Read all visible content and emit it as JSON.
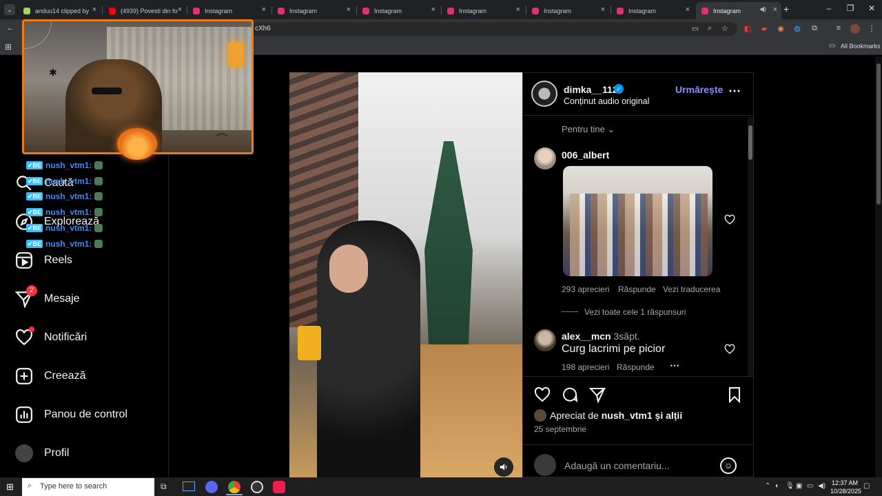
{
  "browser": {
    "tabs": [
      {
        "title": "anduu14 clipped by",
        "color": "#a4d65e"
      },
      {
        "title": "(4939) Povesti din fo",
        "color": "#ff0000"
      },
      {
        "title": "Instagram",
        "color": "#e1306c"
      },
      {
        "title": "Instagram",
        "color": "#e1306c"
      },
      {
        "title": "Instagram",
        "color": "#e1306c"
      },
      {
        "title": "Instagram",
        "color": "#e1306c"
      },
      {
        "title": "Instagram",
        "color": "#e1306c"
      },
      {
        "title": "Instagram",
        "color": "#e1306c"
      },
      {
        "title": "Instagram",
        "color": "#e1306c"
      }
    ],
    "new_tab": "+",
    "url": "cXh6",
    "bookmarks_label": "All Bookmarks"
  },
  "overlay": {
    "chat": [
      {
        "user": "nush_vtm1:"
      },
      {
        "user": "nush_vtm1:"
      },
      {
        "user": "nush_vtm1:"
      },
      {
        "user": "nush_vtm1:"
      },
      {
        "user": "nush_vtm1:"
      },
      {
        "user": "nush_vtm1:"
      }
    ]
  },
  "sidebar": {
    "items": [
      {
        "label": "Caută",
        "icon": "search-icon"
      },
      {
        "label": "Explorează",
        "icon": "compass-icon"
      },
      {
        "label": "Reels",
        "icon": "reels-icon"
      },
      {
        "label": "Mesaje",
        "icon": "messenger-icon",
        "badge": "2"
      },
      {
        "label": "Notificări",
        "icon": "heart-icon"
      },
      {
        "label": "Creează",
        "icon": "plus-square-icon"
      },
      {
        "label": "Panou de control",
        "icon": "dashboard-icon"
      },
      {
        "label": "Profil",
        "icon": "avatar"
      }
    ]
  },
  "post": {
    "author": "dimka__112",
    "audio": "Conținut audio original",
    "follow": "Urmărește",
    "sort": "Pentru tine",
    "comments": [
      {
        "user": "006_albert",
        "likes": "293 aprecieri",
        "reply": "Răspunde",
        "translate": "Vezi traducerea",
        "view_replies": "Vezi toate cele 1 răspunsuri"
      },
      {
        "user": "alex__mcn",
        "time": "3săpt.",
        "text": "Curg lacrimi pe picior",
        "likes": "198 aprecieri",
        "reply": "Răspunde"
      }
    ],
    "liked_by_prefix": "Apreciat de",
    "liked_by_user": "nush_vtm1",
    "liked_by_suffix": "și alții",
    "date": "25 septembrie",
    "comment_placeholder": "Adaugă un comentariu..."
  },
  "taskbar": {
    "search_placeholder": "Type here to search",
    "time": "12:37 AM",
    "date": "10/28/2025"
  },
  "colors": {
    "accent": "#0095f6",
    "follow": "#8c8cff",
    "badge": "#ff3040"
  }
}
